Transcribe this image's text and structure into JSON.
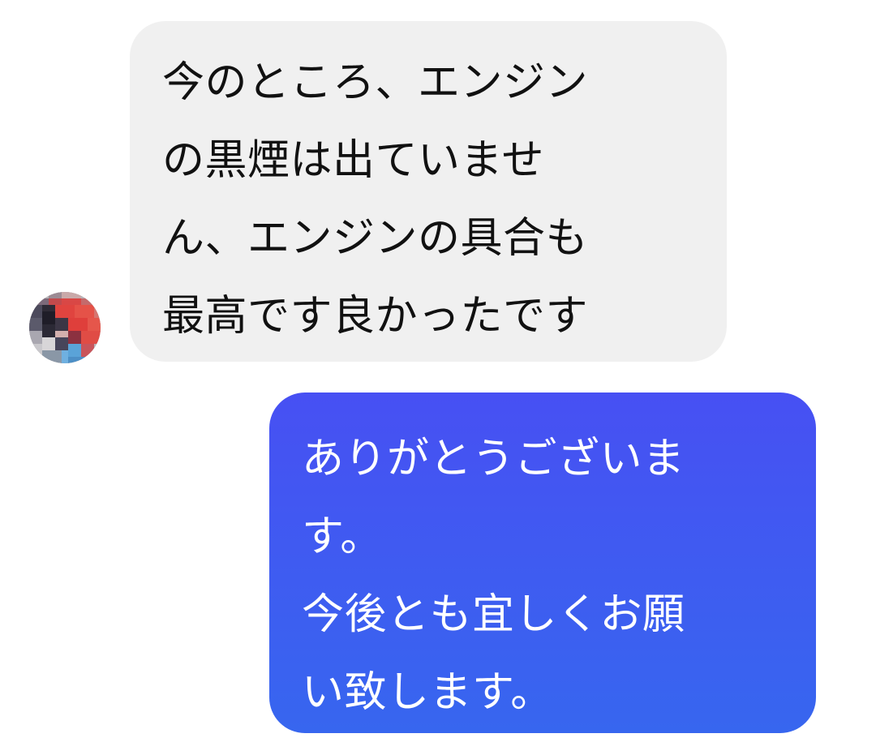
{
  "conversation": {
    "messages": [
      {
        "direction": "incoming",
        "text": "今のところ、エンジン\nの黒煙は出ていませ\nん、エンジンの具合も\n最高です良かったです",
        "avatar_icon": "pixelated-profile-avatar"
      },
      {
        "direction": "outgoing",
        "text": "ありがとうございま\nす。\n今後とも宜しくお願\nい致します。"
      }
    ]
  },
  "colors": {
    "incoming_bubble_bg": "#f0f0f0",
    "incoming_text": "#111111",
    "outgoing_gradient_top": "#4750f3",
    "outgoing_gradient_bottom": "#3766ef",
    "outgoing_text": "#ffffff",
    "page_bg": "#ffffff"
  }
}
